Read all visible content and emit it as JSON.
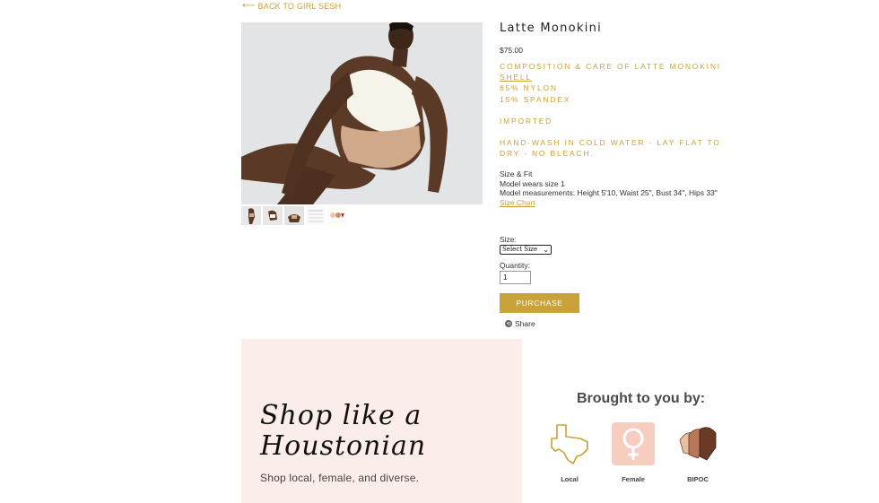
{
  "nav": {
    "back_label": "BACK TO GIRL SESH"
  },
  "product": {
    "title": "Latte Monokini",
    "price": "$75.00",
    "composition_heading": "COMPOSITION & CARE OF LATTE MONOKINI",
    "shell_label": "SHELL",
    "materials": [
      "85% NYLON",
      "15% SPANDEX"
    ],
    "origin": "IMPORTED",
    "care": "HAND-WASH IN COLD WATER - LAY FLAT TO DRY - NO BLEACH.",
    "fit_heading": "Size & Fit",
    "model_size": "Model wears size 1",
    "model_measurements": "Model measurements: Height 5'10, Waist 25\", Bust 34\", Hips 33\"",
    "size_chart_label": "Size Chart"
  },
  "form": {
    "size_label": "Size:",
    "size_selected": "Select Size",
    "quantity_label": "Quantity:",
    "quantity_value": "1",
    "purchase_label": "PURCHASE",
    "share_label": "Share"
  },
  "banner": {
    "heading": "Shop like a Houstonian",
    "subtitle": "Shop local, female, and diverse.",
    "brought_heading": "Brought to you by:",
    "badges": [
      {
        "label": "Local",
        "icon": "texas-icon"
      },
      {
        "label": "Female",
        "icon": "female-symbol-icon"
      },
      {
        "label": "BIPOC",
        "icon": "hands-icon"
      }
    ]
  },
  "colors": {
    "accent": "#c9a23a",
    "banner_bg": "#fbedea",
    "female_badge": "#f6cdbf"
  }
}
